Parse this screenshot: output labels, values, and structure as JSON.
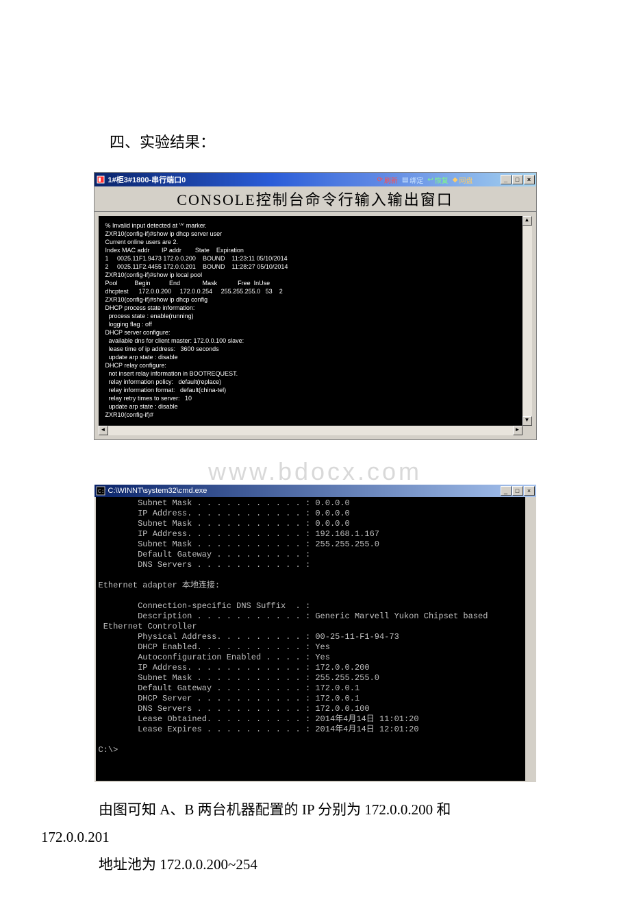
{
  "heading": "四、实验结果：",
  "window1": {
    "title": "1#柜3#1800-串行端口0",
    "tags": {
      "refresh": "刷新",
      "bind": "绑定",
      "restore": "恢复",
      "netdisk": "网盘"
    },
    "console_header": "CONSOLE控制台命令行输入输出窗口",
    "terminal_text": "% Invalid input detected at '^' marker.\nZXR10(config-if)#show ip dhcp server user\nCurrent online users are 2.\nIndex MAC addr       IP addr        State    Expiration\n1     0025.11F1.9473 172.0.0.200    BOUND    11:23:11 05/10/2014\n2     0025.11F2.4455 172.0.0.201    BOUND    11:28:27 05/10/2014\nZXR10(config-if)#show ip local pool\nPool          Begin           End             Mask            Free  InUse\ndhcptest      172.0.0.200     172.0.0.254     255.255.255.0   53    2\nZXR10(config-if)#show ip dhcp config\nDHCP process state information:\n  process state : enable(running)\n  logging flag : off\nDHCP server configure:\n  available dns for client master: 172.0.0.100 slave:\n  lease time of ip address:   3600 seconds\n  update arp state : disable\nDHCP relay configure:\n  not insert relay information in BOOTREQUEST.\n  relay information policy:   default(replace)\n  relay information format:   default(china-tel)\n  relay retry times to server:   10\n  update arp state : disable\nZXR10(config-if)#"
  },
  "watermark": "www.bdocx.com",
  "window2": {
    "title": "C:\\WINNT\\system32\\cmd.exe",
    "cmd_text": "        Subnet Mask . . . . . . . . . . . : 0.0.0.0\n        IP Address. . . . . . . . . . . . : 0.0.0.0\n        Subnet Mask . . . . . . . . . . . : 0.0.0.0\n        IP Address. . . . . . . . . . . . : 192.168.1.167\n        Subnet Mask . . . . . . . . . . . : 255.255.255.0\n        Default Gateway . . . . . . . . . :\n        DNS Servers . . . . . . . . . . . :\n\nEthernet adapter 本地连接:\n\n        Connection-specific DNS Suffix  . :\n        Description . . . . . . . . . . . : Generic Marvell Yukon Chipset based\n Ethernet Controller\n        Physical Address. . . . . . . . . : 00-25-11-F1-94-73\n        DHCP Enabled. . . . . . . . . . . : Yes\n        Autoconfiguration Enabled . . . . : Yes\n        IP Address. . . . . . . . . . . . : 172.0.0.200\n        Subnet Mask . . . . . . . . . . . : 255.255.255.0\n        Default Gateway . . . . . . . . . : 172.0.0.1\n        DHCP Server . . . . . . . . . . . : 172.0.0.1\n        DNS Servers . . . . . . . . . . . : 172.0.0.100\n        Lease Obtained. . . . . . . . . . : 2014年4月14日 11:01:20\n        Lease Expires . . . . . . . . . . : 2014年4月14日 12:01:20\n\nC:\\>"
  },
  "body": {
    "p1": "由图可知 A、B 两台机器配置的 IP 分别为 172.0.0.200 和",
    "p1b": "172.0.0.201",
    "p2": "地址池为 172.0.0.200~254"
  },
  "win_controls": {
    "min": "_",
    "max": "□",
    "close": "×"
  },
  "scroll": {
    "up": "▲",
    "down": "▼",
    "left": "◄",
    "right": "►"
  }
}
